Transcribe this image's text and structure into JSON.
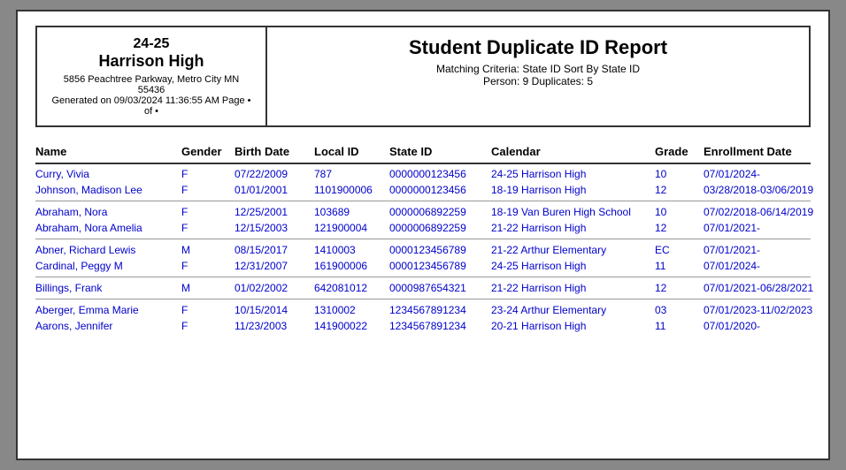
{
  "header": {
    "school_year": "24-25",
    "school_name": "Harrison High",
    "address": "5856 Peachtree Parkway, Metro City MN 55436",
    "generated": "Generated on 09/03/2024 11:36:55 AM Page • of •",
    "report_title": "Student Duplicate ID Report",
    "criteria_line1": "Matching Criteria: State ID Sort By State ID",
    "criteria_line2": "Person: 9 Duplicates: 5"
  },
  "columns": {
    "name": "Name",
    "gender": "Gender",
    "birth_date": "Birth Date",
    "local_id": "Local ID",
    "state_id": "State ID",
    "calendar": "Calendar",
    "grade": "Grade",
    "enrollment_date": "Enrollment Date"
  },
  "groups": [
    {
      "rows": [
        {
          "name": "Curry, Vivia",
          "gender": "F",
          "birth_date": "07/22/2009",
          "local_id": "787",
          "state_id": "0000000123456",
          "calendar": "24-25 Harrison High",
          "grade": "10",
          "enrollment_date": "07/01/2024-"
        },
        {
          "name": "Johnson, Madison Lee",
          "gender": "F",
          "birth_date": "01/01/2001",
          "local_id": "1101900006",
          "state_id": "0000000123456",
          "calendar": "18-19 Harrison High",
          "grade": "12",
          "enrollment_date": "03/28/2018-03/06/2019"
        }
      ]
    },
    {
      "rows": [
        {
          "name": "Abraham, Nora",
          "gender": "F",
          "birth_date": "12/25/2001",
          "local_id": "103689",
          "state_id": "0000006892259",
          "calendar": "18-19 Van Buren High School",
          "grade": "10",
          "enrollment_date": "07/02/2018-06/14/2019"
        },
        {
          "name": "Abraham, Nora Amelia",
          "gender": "F",
          "birth_date": "12/15/2003",
          "local_id": "121900004",
          "state_id": "0000006892259",
          "calendar": "21-22 Harrison High",
          "grade": "12",
          "enrollment_date": "07/01/2021-"
        }
      ]
    },
    {
      "rows": [
        {
          "name": "Abner, Richard Lewis",
          "gender": "M",
          "birth_date": "08/15/2017",
          "local_id": "1410003",
          "state_id": "0000123456789",
          "calendar": "21-22 Arthur Elementary",
          "grade": "EC",
          "enrollment_date": "07/01/2021-"
        },
        {
          "name": "Cardinal, Peggy M",
          "gender": "F",
          "birth_date": "12/31/2007",
          "local_id": "161900006",
          "state_id": "0000123456789",
          "calendar": "24-25 Harrison High",
          "grade": "11",
          "enrollment_date": "07/01/2024-"
        }
      ]
    },
    {
      "rows": [
        {
          "name": "Billings, Frank",
          "gender": "M",
          "birth_date": "01/02/2002",
          "local_id": "642081012",
          "state_id": "0000987654321",
          "calendar": "21-22 Harrison High",
          "grade": "12",
          "enrollment_date": "07/01/2021-06/28/2021"
        }
      ]
    },
    {
      "rows": [
        {
          "name": "Aberger, Emma Marie",
          "gender": "F",
          "birth_date": "10/15/2014",
          "local_id": "1310002",
          "state_id": "1234567891234",
          "calendar": "23-24 Arthur Elementary",
          "grade": "03",
          "enrollment_date": "07/01/2023-11/02/2023"
        },
        {
          "name": "Aarons, Jennifer",
          "gender": "F",
          "birth_date": "11/23/2003",
          "local_id": "141900022",
          "state_id": "1234567891234",
          "calendar": "20-21 Harrison High",
          "grade": "11",
          "enrollment_date": "07/01/2020-"
        }
      ]
    }
  ]
}
